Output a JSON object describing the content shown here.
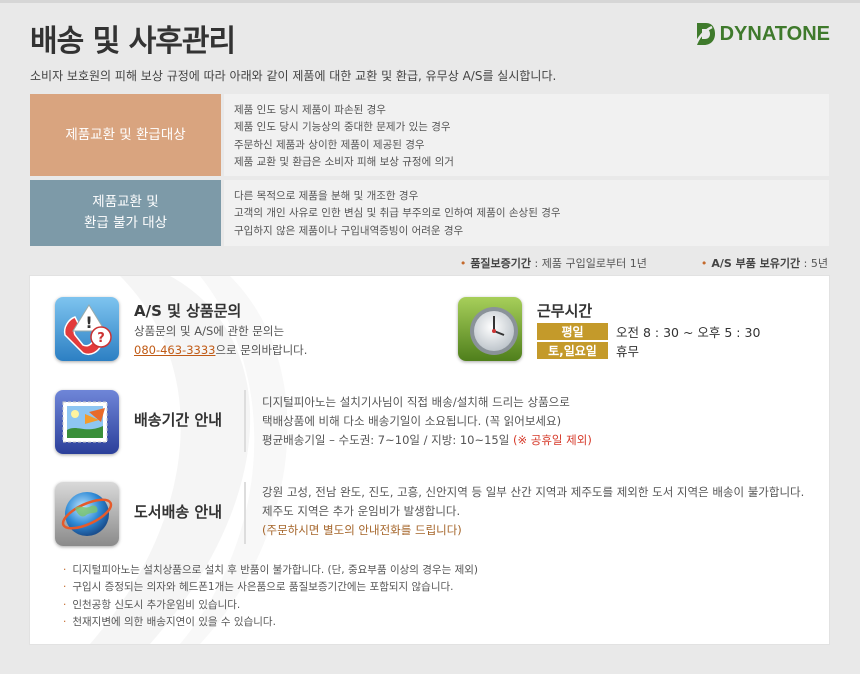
{
  "header": {
    "title": "배송 및 사후관리",
    "logo_text": "DYNATONE",
    "subtitle": "소비자 보호원의 피해 보상 규정에 따라 아래와 같이 제품에 대한 교환 및 환급, 유무상 A/S를 실시합니다."
  },
  "policies": [
    {
      "label_lines": [
        "제품교환 및 환급대상"
      ],
      "items": [
        "제품 인도 당시 제품이 파손된 경우",
        "제품 인도 당시 기능상의 중대한 문제가 있는 경우",
        "주문하신 제품과 상이한 제품이 제공된 경우",
        "제품 교환 및 환급은 소비자 피해 보상 규정에 의거"
      ]
    },
    {
      "label_lines": [
        "제품교환 및",
        "환급 불가 대상"
      ],
      "items": [
        "다른 목적으로 제품을 분해 및 개조한 경우",
        "고객의 개인 사유로 인한 변심 및 취급 부주의로 인하여 제품이 손상된 경우",
        "구입하지 않은 제품이나 구입내역증빙이 어려운 경우"
      ]
    }
  ],
  "warranty": [
    {
      "label": "품질보증기간",
      "value": " : 제품 구입일로부터 1년"
    },
    {
      "label": "A/S 부품 보유기간",
      "value": " : 5년"
    }
  ],
  "as_inquiry": {
    "title": "A/S 및 상품문의",
    "line1": "상품문의 및 A/S에 관한 문의는",
    "phone": "080-463-3333",
    "line2_suffix": "으로 문의바랍니다."
  },
  "hours": {
    "title": "근무시간",
    "rows": [
      {
        "day": "평일",
        "time": "오전 8 : 30 ~ 오후 5 : 30"
      },
      {
        "day": "토,일요일",
        "time": "휴무"
      }
    ]
  },
  "delivery": {
    "title": "배송기간 안내",
    "line1": "디지털피아노는 설치기사님이 직접 배송/설치해 드리는 상품으로",
    "line2": "택배상품에 비해 다소 배송기일이 소요됩니다. (꼭 읽어보세요)",
    "line3": "평균배송기일 – 수도권: 7~10일 / 지방: 10~15일",
    "line3_note": " (※ 공휴일 제외)"
  },
  "island": {
    "title": "도서배송 안내",
    "line1": "강원 고성, 전남 완도, 진도, 고흥, 신안지역 등 일부 산간 지역과 제주도를 제외한 도서 지역은 배송이 불가합니다.",
    "line2": "제주도 지역은 추가 운임비가 발생합니다.",
    "line3": "(주문하시면 별도의 안내전화를 드립니다)"
  },
  "notes": [
    "디지털피아노는 설치상품으로 설치 후 반품이 불가합니다. (단, 중요부품 이상의 경우는 제외)",
    "구입시 증정되는 의자와 헤드폰1개는 사은품으로 품질보증기간에는 포함되지 않습니다.",
    "인천공항 신도시 추가운임비 있습니다.",
    "천재지변에 의한 배송지연이 있을 수 있습니다."
  ],
  "colors": {
    "accent_orange": "#d9a47f",
    "accent_slate": "#7d9aa8",
    "badge_gold": "#c49a2a",
    "brand_green": "#3f7a2c"
  }
}
